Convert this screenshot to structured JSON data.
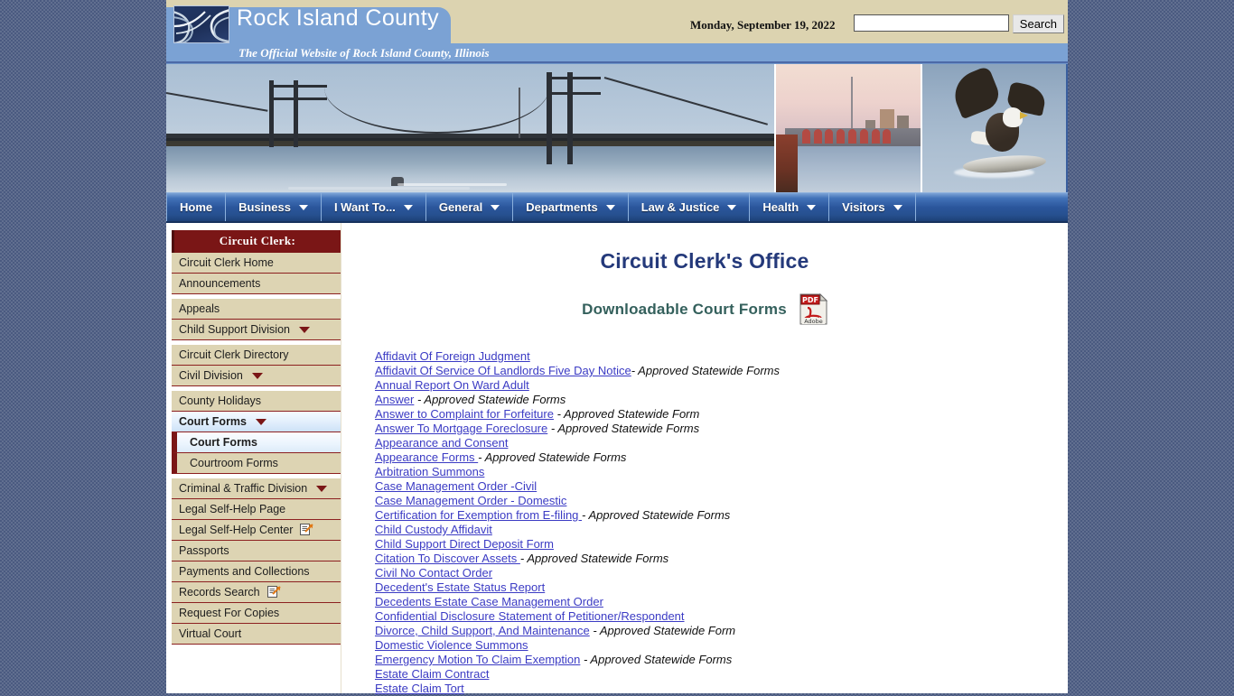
{
  "site": {
    "title": "Rock Island County",
    "tagline": "The Official Website of Rock Island County, Illinois",
    "logo_icon": "river-waves-logo"
  },
  "header": {
    "date": "Monday, September 19, 2022",
    "search": {
      "value": "",
      "placeholder": "",
      "button_label": "Search",
      "icon": "search-icon"
    }
  },
  "banner": {
    "images": [
      {
        "name": "centennial-bridge-photo",
        "alt": "Suspension bridge over the Mississippi River"
      },
      {
        "name": "river-lock-dam-photo",
        "alt": "Lock and dam at dusk"
      },
      {
        "name": "bald-eagle-photo",
        "alt": "Bald eagle landing on a log in the river"
      }
    ]
  },
  "nav": {
    "items": [
      {
        "label": "Home",
        "caret": false
      },
      {
        "label": "Business",
        "caret": true
      },
      {
        "label": "I Want To...",
        "caret": true
      },
      {
        "label": "General",
        "caret": true
      },
      {
        "label": "Departments",
        "caret": true
      },
      {
        "label": "Law & Justice",
        "caret": true
      },
      {
        "label": "Health",
        "caret": true
      },
      {
        "label": "Visitors",
        "caret": true
      }
    ]
  },
  "sidebar": {
    "heading": "Circuit Clerk:",
    "items": [
      {
        "label": "Circuit Clerk Home",
        "caret": false,
        "ext": false,
        "state": "normal",
        "sub": false,
        "gap": false
      },
      {
        "label": "Announcements",
        "caret": false,
        "ext": false,
        "state": "normal",
        "sub": false,
        "gap": false
      },
      {
        "label": "Appeals",
        "caret": false,
        "ext": false,
        "state": "normal",
        "sub": false,
        "gap": true
      },
      {
        "label": "Child Support Division",
        "caret": true,
        "ext": false,
        "state": "normal",
        "sub": false,
        "gap": false
      },
      {
        "label": "Circuit Clerk Directory",
        "caret": false,
        "ext": false,
        "state": "normal",
        "sub": false,
        "gap": true
      },
      {
        "label": "Civil Division",
        "caret": true,
        "ext": false,
        "state": "normal",
        "sub": false,
        "gap": false
      },
      {
        "label": "County Holidays",
        "caret": false,
        "ext": false,
        "state": "normal",
        "sub": false,
        "gap": true
      },
      {
        "label": "Court Forms",
        "caret": true,
        "ext": false,
        "state": "active",
        "sub": false,
        "gap": false
      },
      {
        "label": "Court Forms",
        "caret": false,
        "ext": false,
        "state": "active",
        "sub": true,
        "gap": false
      },
      {
        "label": "Courtroom Forms",
        "caret": false,
        "ext": false,
        "state": "subnormal",
        "sub": true,
        "gap": false
      },
      {
        "label": "Criminal & Traffic Division",
        "caret": true,
        "ext": false,
        "state": "normal",
        "sub": false,
        "gap": true
      },
      {
        "label": "Legal Self-Help Page",
        "caret": false,
        "ext": false,
        "state": "normal",
        "sub": false,
        "gap": false
      },
      {
        "label": "Legal Self-Help Center",
        "caret": false,
        "ext": true,
        "state": "normal",
        "sub": false,
        "gap": false
      },
      {
        "label": "Passports",
        "caret": false,
        "ext": false,
        "state": "normal",
        "sub": false,
        "gap": false
      },
      {
        "label": "Payments and Collections",
        "caret": false,
        "ext": false,
        "state": "normal",
        "sub": false,
        "gap": false
      },
      {
        "label": "Records Search",
        "caret": false,
        "ext": true,
        "state": "normal",
        "sub": false,
        "gap": false
      },
      {
        "label": "Request For Copies",
        "caret": false,
        "ext": false,
        "state": "normal",
        "sub": false,
        "gap": false
      },
      {
        "label": "Virtual Court",
        "caret": false,
        "ext": false,
        "state": "normal",
        "sub": false,
        "gap": false
      }
    ]
  },
  "main": {
    "title": "Circuit Clerk's Office",
    "subtitle": "Downloadable Court Forms",
    "pdf_icon": {
      "name": "adobe-pdf-icon",
      "badge": "PDF",
      "caption": "Adobe"
    },
    "forms": [
      {
        "link": "Affidavit Of Foreign Judgment",
        "note": ""
      },
      {
        "link": "Affidavit Of Service Of Landlords Five Day Notice",
        "note": "- Approved Statewide Forms"
      },
      {
        "link": "Annual Report On Ward Adult",
        "note": ""
      },
      {
        "link": "Answer",
        "note": " - Approved Statewide Forms"
      },
      {
        "link": "Answer to Complaint for Forfeiture",
        "note": " - Approved Statewide Form"
      },
      {
        "link": "Answer To Mortgage Foreclosure",
        "note": " - Approved Statewide Forms"
      },
      {
        "link": "Appearance and Consent",
        "note": ""
      },
      {
        "link": "Appearance Forms ",
        "note": "- Approved Statewide Forms"
      },
      {
        "link": "Arbitration Summons",
        "note": ""
      },
      {
        "link": "Case Management Order -Civil",
        "note": ""
      },
      {
        "link": "Case Management Order - Domestic",
        "note": ""
      },
      {
        "link": "Certification for Exemption from E-filing ",
        "note": "- Approved Statewide Forms"
      },
      {
        "link": "Child Custody Affidavit   ",
        "note": ""
      },
      {
        "link": "Child Support Direct Deposit Form",
        "note": ""
      },
      {
        "link": "Citation To Discover Assets ",
        "note": "- Approved Statewide Forms"
      },
      {
        "link": "Civil No Contact Order",
        "note": ""
      },
      {
        "link": "Decedent's Estate Status Report ",
        "note": ""
      },
      {
        "link": "Decedents Estate Case Management Order",
        "note": ""
      },
      {
        "link": "Confidential Disclosure Statement of Petitioner/Respondent",
        "note": ""
      },
      {
        "link": "Divorce, Child Support, And Maintenance",
        "note": " - Approved Statewide Form"
      },
      {
        "link": "Domestic Violence Summons ",
        "note": ""
      },
      {
        "link": "Emergency Motion To Claim Exemption",
        "note": " - Approved Statewide Forms"
      },
      {
        "link": "Estate Claim Contract",
        "note": ""
      },
      {
        "link": "Estate Claim Tort",
        "note": ""
      }
    ]
  },
  "colors": {
    "header_band": "#dcd3b0",
    "header_blue": "#7ba2d4",
    "nav_blue": "#2b569c",
    "sidebar_tan": "#ddd4b3",
    "sidebar_red": "#7a1616",
    "title_navy": "#24397a",
    "subtitle_teal": "#34605c",
    "link_blue": "#3b3bc4",
    "page_bg": "#4a5a80"
  }
}
